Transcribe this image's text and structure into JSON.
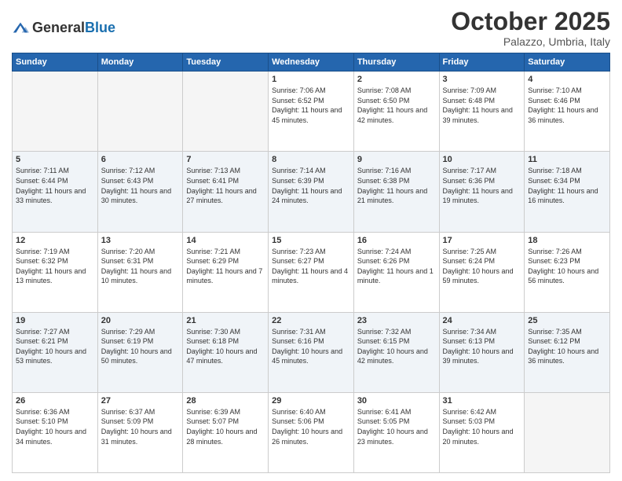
{
  "header": {
    "logo_general": "General",
    "logo_blue": "Blue",
    "month": "October 2025",
    "location": "Palazzo, Umbria, Italy"
  },
  "days_of_week": [
    "Sunday",
    "Monday",
    "Tuesday",
    "Wednesday",
    "Thursday",
    "Friday",
    "Saturday"
  ],
  "weeks": [
    [
      {
        "day": "",
        "sunrise": "",
        "sunset": "",
        "daylight": ""
      },
      {
        "day": "",
        "sunrise": "",
        "sunset": "",
        "daylight": ""
      },
      {
        "day": "",
        "sunrise": "",
        "sunset": "",
        "daylight": ""
      },
      {
        "day": "1",
        "sunrise": "Sunrise: 7:06 AM",
        "sunset": "Sunset: 6:52 PM",
        "daylight": "Daylight: 11 hours and 45 minutes."
      },
      {
        "day": "2",
        "sunrise": "Sunrise: 7:08 AM",
        "sunset": "Sunset: 6:50 PM",
        "daylight": "Daylight: 11 hours and 42 minutes."
      },
      {
        "day": "3",
        "sunrise": "Sunrise: 7:09 AM",
        "sunset": "Sunset: 6:48 PM",
        "daylight": "Daylight: 11 hours and 39 minutes."
      },
      {
        "day": "4",
        "sunrise": "Sunrise: 7:10 AM",
        "sunset": "Sunset: 6:46 PM",
        "daylight": "Daylight: 11 hours and 36 minutes."
      }
    ],
    [
      {
        "day": "5",
        "sunrise": "Sunrise: 7:11 AM",
        "sunset": "Sunset: 6:44 PM",
        "daylight": "Daylight: 11 hours and 33 minutes."
      },
      {
        "day": "6",
        "sunrise": "Sunrise: 7:12 AM",
        "sunset": "Sunset: 6:43 PM",
        "daylight": "Daylight: 11 hours and 30 minutes."
      },
      {
        "day": "7",
        "sunrise": "Sunrise: 7:13 AM",
        "sunset": "Sunset: 6:41 PM",
        "daylight": "Daylight: 11 hours and 27 minutes."
      },
      {
        "day": "8",
        "sunrise": "Sunrise: 7:14 AM",
        "sunset": "Sunset: 6:39 PM",
        "daylight": "Daylight: 11 hours and 24 minutes."
      },
      {
        "day": "9",
        "sunrise": "Sunrise: 7:16 AM",
        "sunset": "Sunset: 6:38 PM",
        "daylight": "Daylight: 11 hours and 21 minutes."
      },
      {
        "day": "10",
        "sunrise": "Sunrise: 7:17 AM",
        "sunset": "Sunset: 6:36 PM",
        "daylight": "Daylight: 11 hours and 19 minutes."
      },
      {
        "day": "11",
        "sunrise": "Sunrise: 7:18 AM",
        "sunset": "Sunset: 6:34 PM",
        "daylight": "Daylight: 11 hours and 16 minutes."
      }
    ],
    [
      {
        "day": "12",
        "sunrise": "Sunrise: 7:19 AM",
        "sunset": "Sunset: 6:32 PM",
        "daylight": "Daylight: 11 hours and 13 minutes."
      },
      {
        "day": "13",
        "sunrise": "Sunrise: 7:20 AM",
        "sunset": "Sunset: 6:31 PM",
        "daylight": "Daylight: 11 hours and 10 minutes."
      },
      {
        "day": "14",
        "sunrise": "Sunrise: 7:21 AM",
        "sunset": "Sunset: 6:29 PM",
        "daylight": "Daylight: 11 hours and 7 minutes."
      },
      {
        "day": "15",
        "sunrise": "Sunrise: 7:23 AM",
        "sunset": "Sunset: 6:27 PM",
        "daylight": "Daylight: 11 hours and 4 minutes."
      },
      {
        "day": "16",
        "sunrise": "Sunrise: 7:24 AM",
        "sunset": "Sunset: 6:26 PM",
        "daylight": "Daylight: 11 hours and 1 minute."
      },
      {
        "day": "17",
        "sunrise": "Sunrise: 7:25 AM",
        "sunset": "Sunset: 6:24 PM",
        "daylight": "Daylight: 10 hours and 59 minutes."
      },
      {
        "day": "18",
        "sunrise": "Sunrise: 7:26 AM",
        "sunset": "Sunset: 6:23 PM",
        "daylight": "Daylight: 10 hours and 56 minutes."
      }
    ],
    [
      {
        "day": "19",
        "sunrise": "Sunrise: 7:27 AM",
        "sunset": "Sunset: 6:21 PM",
        "daylight": "Daylight: 10 hours and 53 minutes."
      },
      {
        "day": "20",
        "sunrise": "Sunrise: 7:29 AM",
        "sunset": "Sunset: 6:19 PM",
        "daylight": "Daylight: 10 hours and 50 minutes."
      },
      {
        "day": "21",
        "sunrise": "Sunrise: 7:30 AM",
        "sunset": "Sunset: 6:18 PM",
        "daylight": "Daylight: 10 hours and 47 minutes."
      },
      {
        "day": "22",
        "sunrise": "Sunrise: 7:31 AM",
        "sunset": "Sunset: 6:16 PM",
        "daylight": "Daylight: 10 hours and 45 minutes."
      },
      {
        "day": "23",
        "sunrise": "Sunrise: 7:32 AM",
        "sunset": "Sunset: 6:15 PM",
        "daylight": "Daylight: 10 hours and 42 minutes."
      },
      {
        "day": "24",
        "sunrise": "Sunrise: 7:34 AM",
        "sunset": "Sunset: 6:13 PM",
        "daylight": "Daylight: 10 hours and 39 minutes."
      },
      {
        "day": "25",
        "sunrise": "Sunrise: 7:35 AM",
        "sunset": "Sunset: 6:12 PM",
        "daylight": "Daylight: 10 hours and 36 minutes."
      }
    ],
    [
      {
        "day": "26",
        "sunrise": "Sunrise: 6:36 AM",
        "sunset": "Sunset: 5:10 PM",
        "daylight": "Daylight: 10 hours and 34 minutes."
      },
      {
        "day": "27",
        "sunrise": "Sunrise: 6:37 AM",
        "sunset": "Sunset: 5:09 PM",
        "daylight": "Daylight: 10 hours and 31 minutes."
      },
      {
        "day": "28",
        "sunrise": "Sunrise: 6:39 AM",
        "sunset": "Sunset: 5:07 PM",
        "daylight": "Daylight: 10 hours and 28 minutes."
      },
      {
        "day": "29",
        "sunrise": "Sunrise: 6:40 AM",
        "sunset": "Sunset: 5:06 PM",
        "daylight": "Daylight: 10 hours and 26 minutes."
      },
      {
        "day": "30",
        "sunrise": "Sunrise: 6:41 AM",
        "sunset": "Sunset: 5:05 PM",
        "daylight": "Daylight: 10 hours and 23 minutes."
      },
      {
        "day": "31",
        "sunrise": "Sunrise: 6:42 AM",
        "sunset": "Sunset: 5:03 PM",
        "daylight": "Daylight: 10 hours and 20 minutes."
      },
      {
        "day": "",
        "sunrise": "",
        "sunset": "",
        "daylight": ""
      }
    ]
  ]
}
